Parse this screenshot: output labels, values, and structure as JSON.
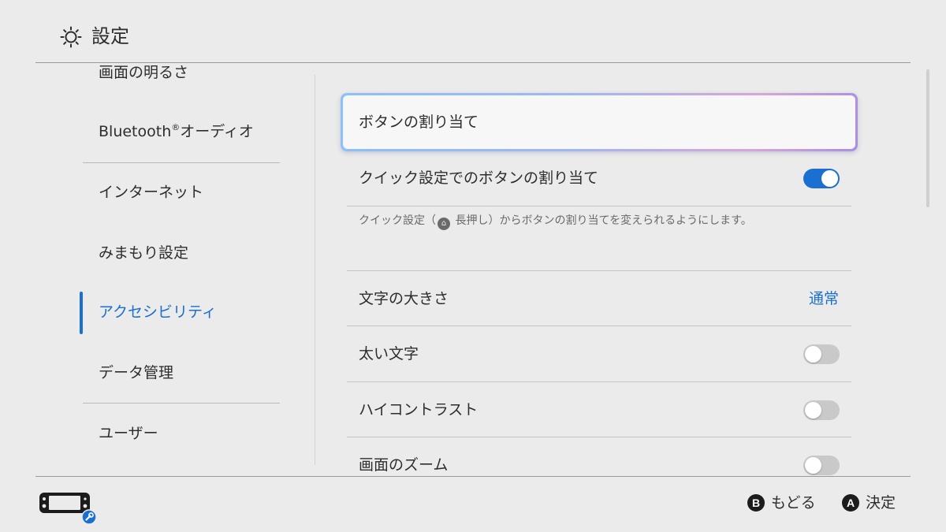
{
  "header": {
    "title": "設定",
    "icon": "sun-icon"
  },
  "sidebar": {
    "items": [
      {
        "label": "画面の明るさ"
      },
      {
        "label": "Bluetooth",
        "sup": "®",
        "label2": "オーディオ"
      },
      {
        "label": "インターネット"
      },
      {
        "label": "みまもり設定"
      },
      {
        "label": "アクセシビリティ",
        "active": true
      },
      {
        "label": "データ管理"
      },
      {
        "label": "ユーザー"
      }
    ]
  },
  "content": {
    "focused_item": {
      "label": "ボタンの割り当て"
    },
    "quick_assign": {
      "label": "クイック設定でのボタンの割り当て",
      "enabled": true
    },
    "quick_assign_desc": {
      "before": "クイック設定（",
      "glyph": "⌂",
      "after": " 長押し）からボタンの割り当てを変えられるようにします。"
    },
    "text_size": {
      "label": "文字の大きさ",
      "value": "通常"
    },
    "bold_text": {
      "label": "太い文字",
      "enabled": false
    },
    "high_contrast": {
      "label": "ハイコントラスト",
      "enabled": false
    },
    "zoom": {
      "label": "画面のズーム",
      "enabled": false
    }
  },
  "footer": {
    "back": {
      "key": "B",
      "label": "もどる"
    },
    "ok": {
      "key": "A",
      "label": "決定"
    },
    "console_icon": "handheld-console-icon",
    "badge_icon": "wrench-icon"
  },
  "colors": {
    "accent": "#1a6fd0",
    "background": "#ebebeb",
    "toggle_off": "#c9c9c9"
  }
}
